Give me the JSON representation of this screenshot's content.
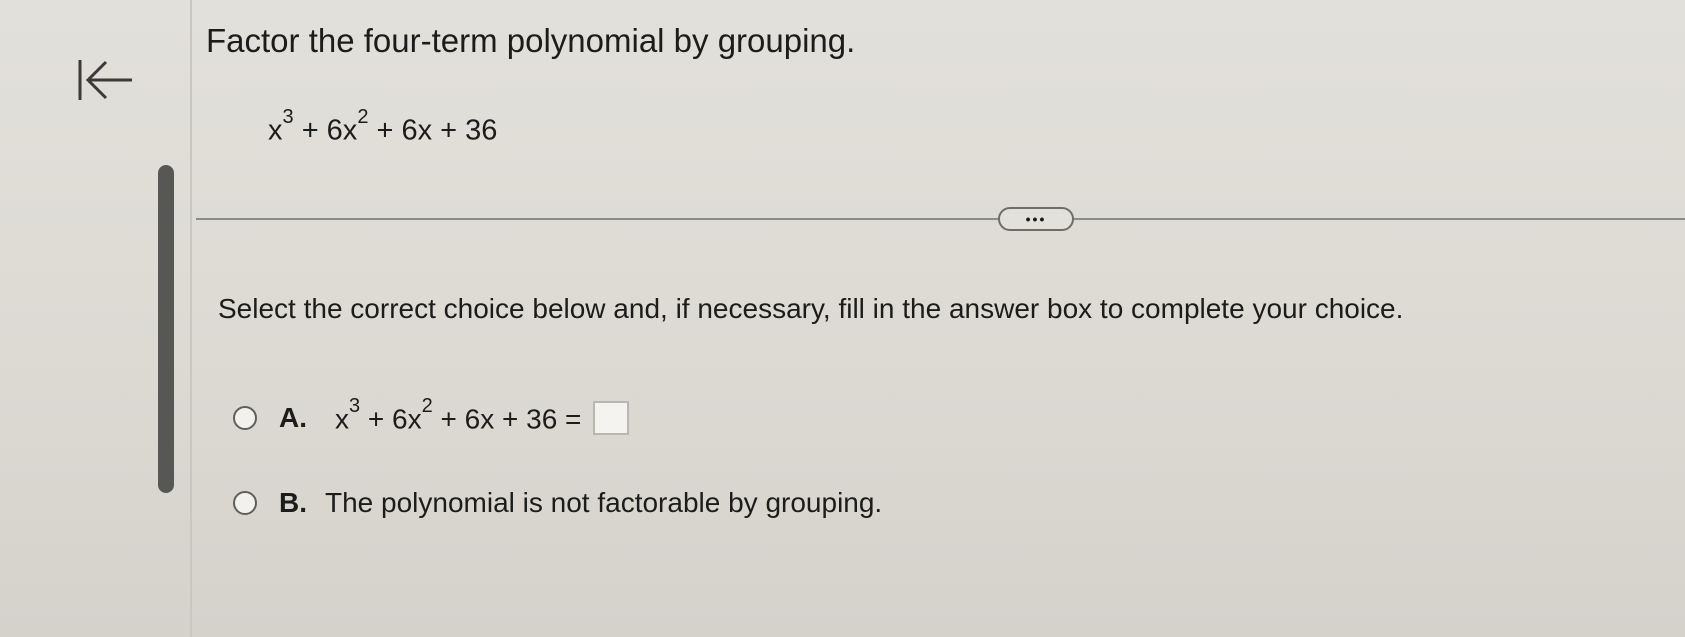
{
  "header": {
    "back_icon": "back-arrow-to-bar-icon"
  },
  "question": {
    "title": "Factor the four-term polynomial by grouping.",
    "expression": {
      "term1_base": "x",
      "term1_exp": "3",
      "term2_prefix": "+ 6x",
      "term2_exp": "2",
      "tail": "+ 6x + 36"
    }
  },
  "more_button": {
    "label": "•••"
  },
  "instruction": "Select the correct choice below and, if necessary, fill in the answer box to complete your choice.",
  "choices": [
    {
      "letter": "A.",
      "math": {
        "term1_base": "x",
        "term1_exp": "3",
        "term2_prefix": "+ 6x",
        "term2_exp": "2",
        "tail": "+ 6x + 36 ="
      },
      "answer_value": ""
    },
    {
      "letter": "B.",
      "text": "The polynomial is not factorable by grouping."
    }
  ]
}
